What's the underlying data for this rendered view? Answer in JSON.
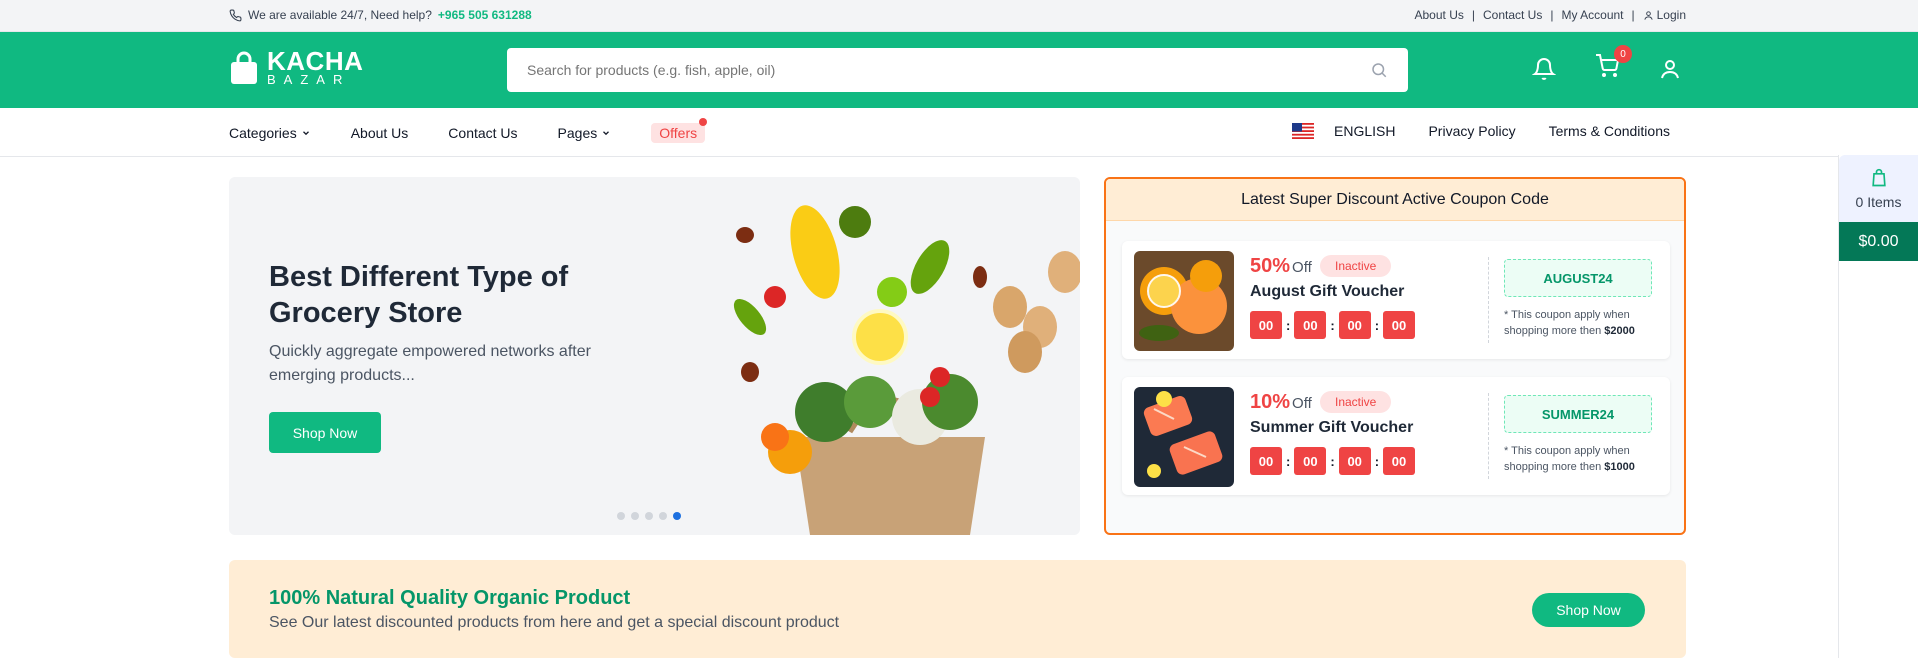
{
  "topbar": {
    "help_text": "We are available 24/7, Need help?",
    "phone": "+965 505 631288",
    "links": [
      "About Us",
      "Contact Us",
      "My Account"
    ],
    "separator": "|",
    "login": "Login"
  },
  "header": {
    "logo_title": "KACHA",
    "logo_sub": "BAZAR",
    "search_placeholder": "Search for products (e.g. fish, apple, oil)",
    "cart_count": "0"
  },
  "nav": {
    "categories": "Categories",
    "about": "About Us",
    "contact": "Contact Us",
    "pages": "Pages",
    "offers": "Offers",
    "language": "ENGLISH",
    "privacy": "Privacy Policy",
    "terms": "Terms & Conditions"
  },
  "hero": {
    "title": "Best Different Type of Grocery Store",
    "subtitle": "Quickly aggregate empowered networks after emerging products...",
    "button": "Shop Now",
    "slides": 5,
    "active_slide": 5
  },
  "coupons": {
    "title": "Latest Super Discount Active Coupon Code",
    "items": [
      {
        "percent": "50%",
        "off": "Off",
        "status": "Inactive",
        "name": "August Gift Voucher",
        "timer": [
          "00",
          "00",
          "00",
          "00"
        ],
        "code": "AUGUST24",
        "note": "* This coupon apply when shopping more then",
        "amount": "$2000"
      },
      {
        "percent": "10%",
        "off": "Off",
        "status": "Inactive",
        "name": "Summer Gift Voucher",
        "timer": [
          "00",
          "00",
          "00",
          "00"
        ],
        "code": "SUMMER24",
        "note": "* This coupon apply when shopping more then",
        "amount": "$1000"
      }
    ]
  },
  "banner": {
    "heading": "100% Natural Quality Organic Product",
    "text": "See Our latest discounted products from here and get a special discount product",
    "button": "Shop Now"
  },
  "side_cart": {
    "items": "0 Items",
    "total": "$0.00"
  },
  "colors": {
    "brand": "#10b981",
    "accent": "#ef4444",
    "coupon_border": "#f97316"
  }
}
